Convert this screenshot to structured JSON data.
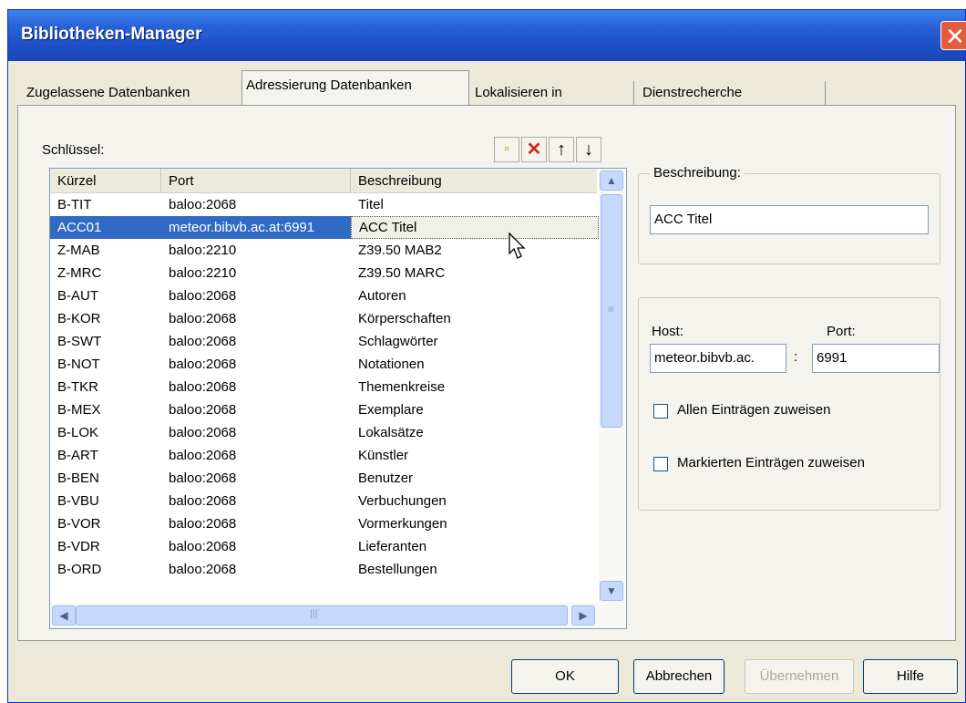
{
  "window": {
    "title": "Bibliotheken-Manager",
    "close_glyph": "✕"
  },
  "tabs": [
    {
      "label": "Zugelassene Datenbanken"
    },
    {
      "label": "Adressierung Datenbanken"
    },
    {
      "label": "Lokalisieren in"
    },
    {
      "label": "Dienstrecherche"
    }
  ],
  "keys_label": "Schlüssel:",
  "toolbar": {
    "new_glyph": "▫",
    "delete_glyph": "✕",
    "up_glyph": "↑",
    "down_glyph": "↓"
  },
  "columns": [
    "Kürzel",
    "Port",
    "Beschreibung"
  ],
  "rows": [
    {
      "code": "B-TIT",
      "port": "baloo:2068",
      "desc": "Titel"
    },
    {
      "code": "ACC01",
      "port": "meteor.bibvb.ac.at:6991",
      "desc": "ACC Titel"
    },
    {
      "code": "Z-MAB",
      "port": "baloo:2210",
      "desc": "Z39.50 MAB2"
    },
    {
      "code": "Z-MRC",
      "port": "baloo:2210",
      "desc": "Z39.50 MARC"
    },
    {
      "code": "B-AUT",
      "port": "baloo:2068",
      "desc": "Autoren"
    },
    {
      "code": "B-KOR",
      "port": "baloo:2068",
      "desc": "Körperschaften"
    },
    {
      "code": "B-SWT",
      "port": "baloo:2068",
      "desc": "Schlagwörter"
    },
    {
      "code": "B-NOT",
      "port": "baloo:2068",
      "desc": "Notationen"
    },
    {
      "code": "B-TKR",
      "port": "baloo:2068",
      "desc": "Themenkreise"
    },
    {
      "code": "B-MEX",
      "port": "baloo:2068",
      "desc": "Exemplare"
    },
    {
      "code": "B-LOK",
      "port": "baloo:2068",
      "desc": "Lokalsätze"
    },
    {
      "code": "B-ART",
      "port": "baloo:2068",
      "desc": "Künstler"
    },
    {
      "code": "B-BEN",
      "port": "baloo:2068",
      "desc": "Benutzer"
    },
    {
      "code": "B-VBU",
      "port": "baloo:2068",
      "desc": "Verbuchungen"
    },
    {
      "code": "B-VOR",
      "port": "baloo:2068",
      "desc": "Vormerkungen"
    },
    {
      "code": "B-VDR",
      "port": "baloo:2068",
      "desc": "Lieferanten"
    },
    {
      "code": "B-ORD",
      "port": "baloo:2068",
      "desc": "Bestellungen"
    }
  ],
  "selected_row": 1,
  "description": {
    "legend": "Beschreibung:",
    "value": "ACC Titel"
  },
  "connection": {
    "host_label": "Host:",
    "port_label": "Port:",
    "host_value": "meteor.bibvb.ac.",
    "separator": ":",
    "port_value": "6991",
    "assign_all_label": "Allen Einträgen zuweisen",
    "assign_all_checked": false,
    "assign_marked_label": "Markierten Einträgen zuweisen",
    "assign_marked_checked": false
  },
  "buttons": {
    "ok": "OK",
    "cancel": "Abbrechen",
    "apply": "Übernehmen",
    "help": "Hilfe"
  },
  "scroll_glyphs": {
    "up": "▲",
    "down": "▼",
    "left": "◀",
    "right": "▶",
    "grip": "≡",
    "hgrip": "|||"
  }
}
